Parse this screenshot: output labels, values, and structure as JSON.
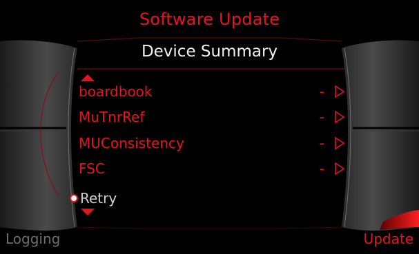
{
  "header": {
    "title": "Software Update",
    "subtitle": "Device Summary"
  },
  "items": [
    {
      "label": "boardbook",
      "value": "-"
    },
    {
      "label": "MuTnrRef",
      "value": "-"
    },
    {
      "label": "MUConsistency",
      "value": "-"
    },
    {
      "label": "FSC",
      "value": "-"
    }
  ],
  "retry": {
    "label": "Retry"
  },
  "footer": {
    "left": "Logging",
    "right": "Update"
  },
  "colors": {
    "accent": "#e8141b",
    "text_white": "#f0f0f0",
    "text_dim": "#6e6e6e",
    "background": "#000000"
  },
  "icons": {
    "scroll_up": "triangle-up-icon",
    "scroll_down": "triangle-down-icon",
    "row_arrow": "play-outline-icon",
    "retry_marker": "radio-circle-icon"
  }
}
